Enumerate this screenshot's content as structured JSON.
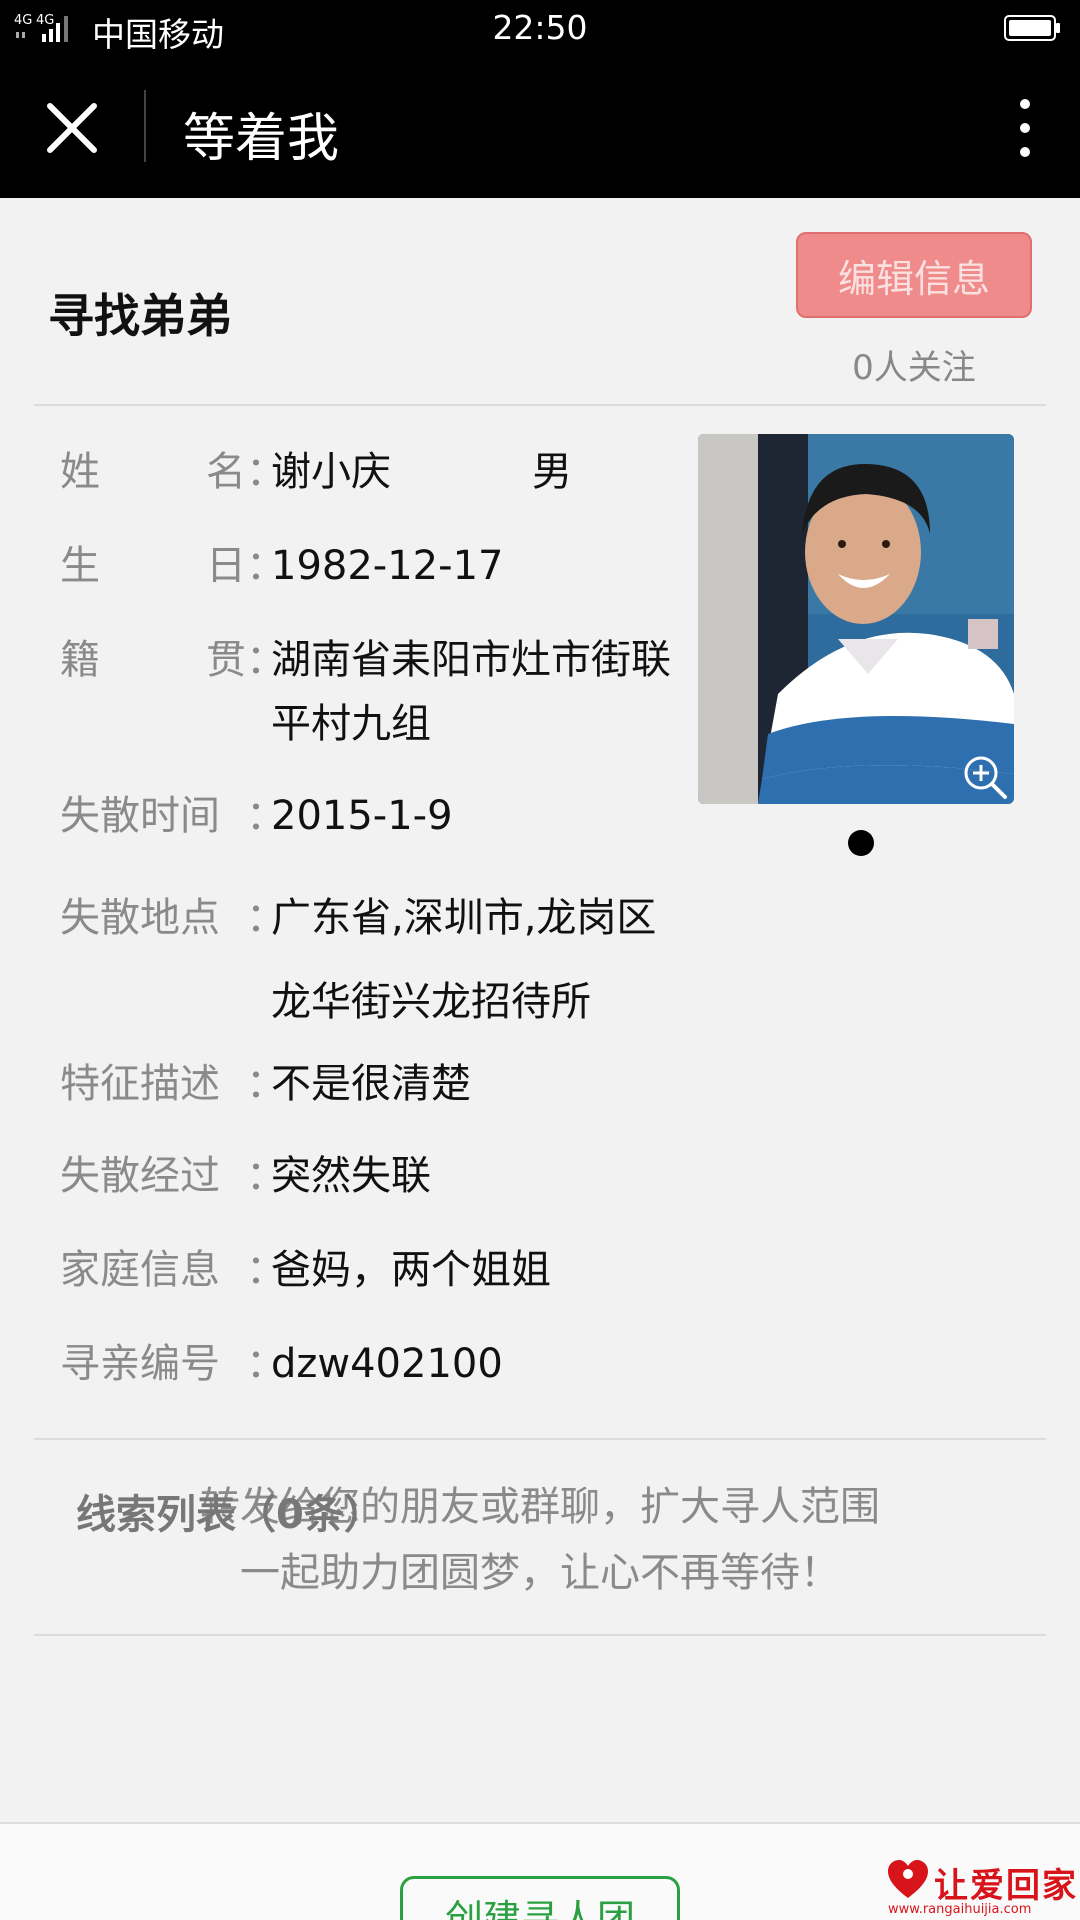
{
  "status_bar": {
    "network": "4G 4G",
    "carrier": "中国移动",
    "time": "22:50"
  },
  "nav": {
    "title": "等着我"
  },
  "header": {
    "title": "寻找弟弟",
    "edit_button": "编辑信息",
    "followers": "0人关注"
  },
  "info": {
    "name_label_1": "姓",
    "name_label_2": "名",
    "name": "谢小庆",
    "gender": "男",
    "birthday_label_1": "生",
    "birthday_label_2": "日",
    "birthday": "1982-12-17",
    "hometown_label_1": "籍",
    "hometown_label_2": "贯",
    "hometown_line1": "湖南省耒阳市灶市街联",
    "hometown_line2": "平村九组",
    "lost_time_label": "失散时间",
    "lost_time": "2015-1-9",
    "lost_place_label": "失散地点",
    "lost_place_line1": "广东省,深圳市,龙岗区",
    "lost_place_line2": "龙华街兴龙招待所",
    "features_label": "特征描述",
    "features": "不是很清楚",
    "story_label": "失散经过",
    "story": "突然失联",
    "family_label": "家庭信息",
    "family": "爸妈，两个姐姐",
    "id_label": "寻亲编号",
    "id": "dzw402100",
    "colon": "："
  },
  "share": {
    "line1": "转发给您的朋友或群聊，扩大寻人范围",
    "line2": "一起助力团圆梦，让心不再等待！"
  },
  "clues": {
    "title": "线索列表（0条）"
  },
  "bottom": {
    "create_button": "创建寻人团"
  },
  "watermark": {
    "text": "让爱回家",
    "url": "www.rangaihuijia.com"
  },
  "colors": {
    "nav_bg": "#000000",
    "edit_button_bg": "#ef8b8b",
    "create_button_border": "#2aa043",
    "watermark": "#d8141b"
  },
  "icons": [
    "signal-icon",
    "battery-icon",
    "close-icon",
    "more-vertical-icon",
    "zoom-in-icon"
  ]
}
